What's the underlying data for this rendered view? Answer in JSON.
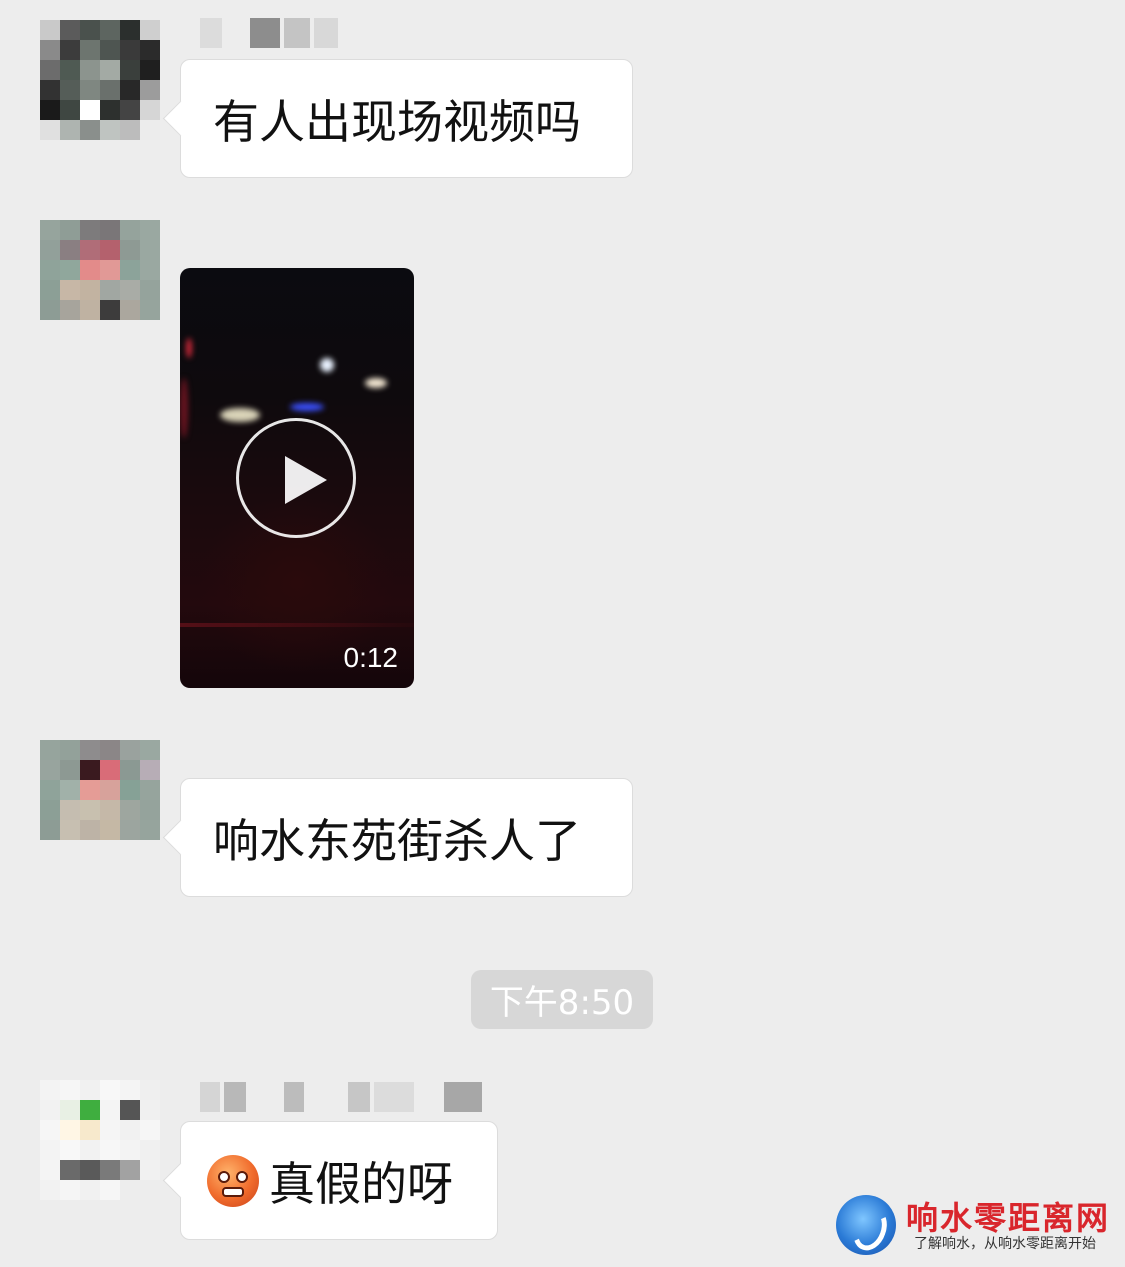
{
  "chat": {
    "messages": [
      {
        "type": "text",
        "sender_avatar": "pixelated-avatar",
        "text": "有人出现场视频吗"
      },
      {
        "type": "video",
        "sender_avatar": "pixelated-avatar",
        "duration": "0:12"
      },
      {
        "type": "text",
        "sender_avatar": "pixelated-avatar",
        "text": "响水东苑街杀人了"
      },
      {
        "type": "timestamp",
        "text": "下午8:50"
      },
      {
        "type": "text",
        "sender_avatar": "pixelated-avatar",
        "emoji": "angry-face-emoji",
        "text": "真假的呀"
      }
    ]
  },
  "watermark": {
    "title": "响水零距离网",
    "subtitle": "了解响水，从响水零距离开始",
    "logo_icon": "swirl-logo-icon"
  },
  "colors": {
    "background": "#ededed",
    "bubble": "#ffffff",
    "timestamp_pill": "#d7d7d7",
    "watermark_red": "#d9262c"
  }
}
